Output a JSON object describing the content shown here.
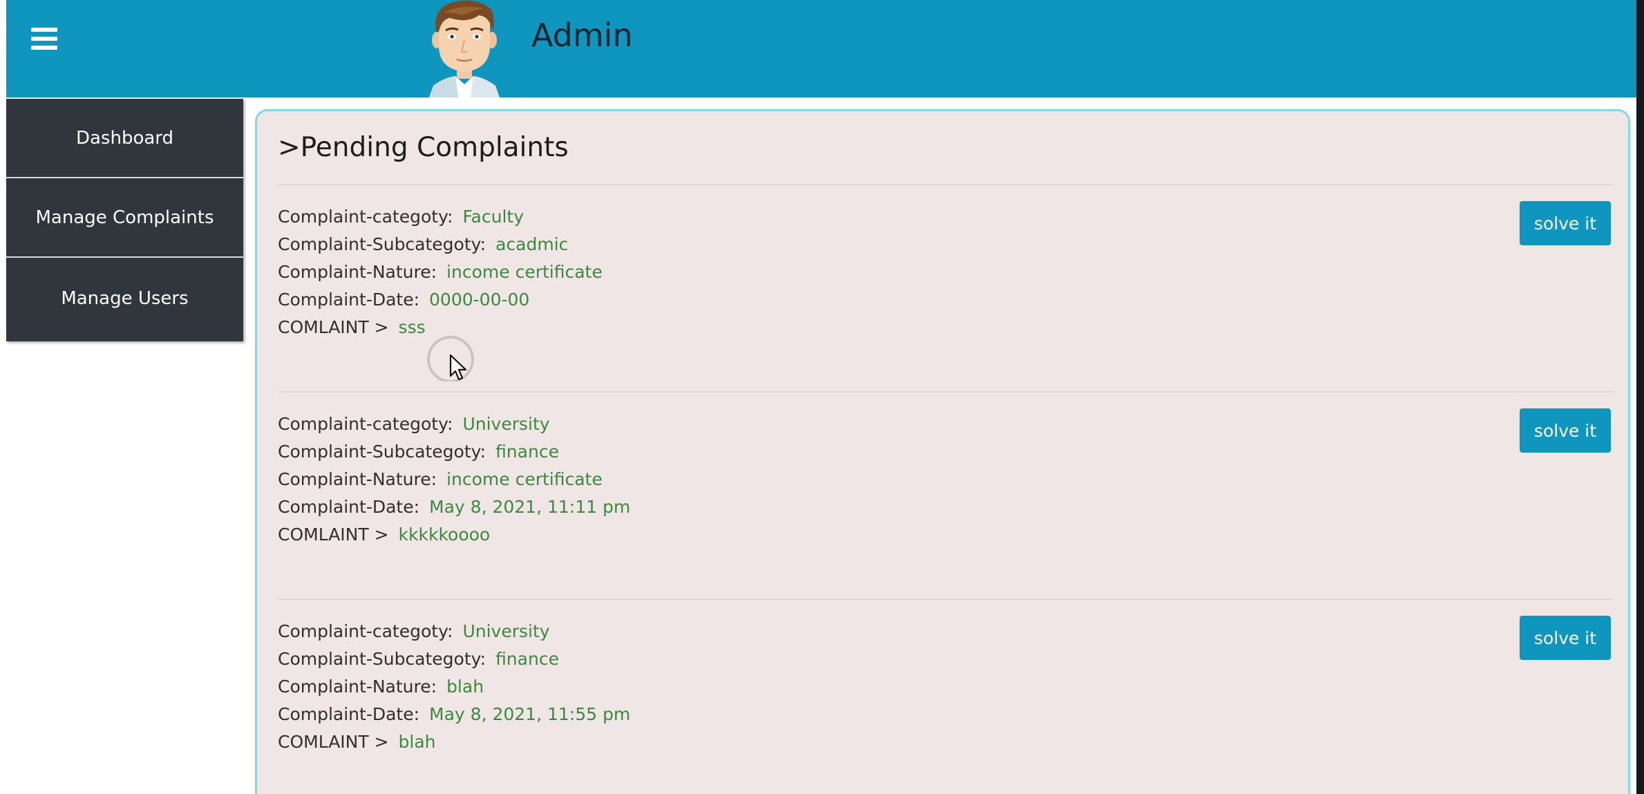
{
  "header": {
    "title": "Admin"
  },
  "sidebar": {
    "items": [
      {
        "label": "Dashboard"
      },
      {
        "label": "Manage Complaints"
      },
      {
        "label": "Manage Users"
      }
    ]
  },
  "main": {
    "title": ">Pending Complaints",
    "labels": {
      "category": "Complaint-categoty:",
      "subcategory": "Complaint-Subcategoty:",
      "nature": "Complaint-Nature:",
      "date": "Complaint-Date:",
      "complaint": "COMLAINT >"
    },
    "solve_label": "solve it",
    "complaints": [
      {
        "category": "Faculty",
        "subcategory": "acadmic",
        "nature": "income certificate",
        "date": "0000-00-00",
        "complaint": "sss"
      },
      {
        "category": "University",
        "subcategory": "finance",
        "nature": "income certificate",
        "date": "May 8, 2021, 11:11 pm",
        "complaint": "kkkkkoooo"
      },
      {
        "category": "University",
        "subcategory": "finance",
        "nature": "blah",
        "date": "May 8, 2021, 11:55 pm",
        "complaint": "blah"
      }
    ]
  },
  "colors": {
    "header": "#0e96bf",
    "sidebar": "#31363d",
    "panel": "#f0e6e6",
    "panel_border": "#7fdbe6",
    "value_text": "#3a8a3e",
    "button": "#0e96bf"
  },
  "icons": {
    "menu": "hamburger-icon",
    "avatar": "admin-avatar",
    "cursor": "mouse-cursor-icon"
  }
}
